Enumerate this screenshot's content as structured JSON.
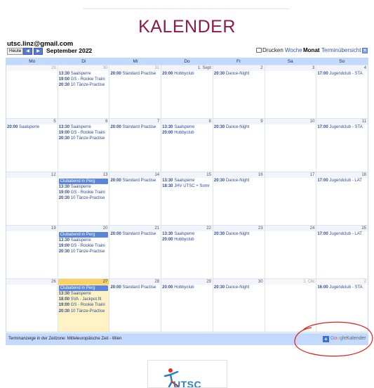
{
  "page": {
    "title": "KALENDER"
  },
  "calendar": {
    "owner": "utsc.linz@gmail.com",
    "toolbar": {
      "today": "Heute",
      "prev": "◀",
      "next": "▶",
      "month": "September 2022",
      "print": "Drucken",
      "week": "Woche",
      "month_view": "Monat",
      "agenda": "Terminübersicht"
    },
    "weekdays": [
      "Mo",
      "Di",
      "Mi",
      "Do",
      "Fr",
      "Sa",
      "So"
    ],
    "weeks": [
      [
        {
          "num": "29",
          "other": true,
          "events": []
        },
        {
          "num": "30",
          "other": true,
          "events": [
            {
              "time": "13:30",
              "title": "Saalsperre"
            },
            {
              "time": "19:00",
              "title": "GS - Rookie Traini"
            },
            {
              "time": "20:30",
              "title": "10 Tänze-Practise"
            }
          ]
        },
        {
          "num": "31",
          "other": true,
          "events": [
            {
              "time": "20:00",
              "title": "Standard Practise"
            }
          ]
        },
        {
          "num": "1. Sept",
          "events": [
            {
              "time": "20:00",
              "title": "Hobbyclub"
            }
          ]
        },
        {
          "num": "2",
          "events": [
            {
              "time": "20:30",
              "title": "Dance-Night"
            }
          ]
        },
        {
          "num": "3",
          "events": []
        },
        {
          "num": "4",
          "events": [
            {
              "time": "17:00",
              "title": "Jugendclub - STA"
            }
          ]
        }
      ],
      [
        {
          "num": "5",
          "events": [
            {
              "time": "20:00",
              "title": "Saalsperre"
            }
          ]
        },
        {
          "num": "6",
          "events": [
            {
              "time": "13:30",
              "title": "Saalsperre"
            },
            {
              "time": "19:00",
              "title": "GS - Rookie Traini"
            },
            {
              "time": "20:30",
              "title": "10 Tänze-Practise"
            }
          ]
        },
        {
          "num": "7",
          "events": [
            {
              "time": "20:00",
              "title": "Standard Practise"
            }
          ]
        },
        {
          "num": "8",
          "events": [
            {
              "time": "13:30",
              "title": "Saalsperre"
            },
            {
              "time": "20:00",
              "title": "Hobbyclub"
            }
          ]
        },
        {
          "num": "9",
          "events": [
            {
              "time": "20:30",
              "title": "Dance-Night"
            }
          ]
        },
        {
          "num": "10",
          "events": []
        },
        {
          "num": "11",
          "events": [
            {
              "time": "17:00",
              "title": "Jugendclub - STA"
            }
          ]
        }
      ],
      [
        {
          "num": "12",
          "events": []
        },
        {
          "num": "13",
          "events": [
            {
              "allday": true,
              "title": "Clubabend in Perg"
            },
            {
              "time": "13:30",
              "title": "Saalsperre"
            },
            {
              "time": "19:00",
              "title": "GS - Rookie Traini"
            },
            {
              "time": "20:30",
              "title": "10 Tänze-Practise"
            }
          ]
        },
        {
          "num": "14",
          "events": [
            {
              "time": "20:00",
              "title": "Standard Practise"
            }
          ]
        },
        {
          "num": "15",
          "events": [
            {
              "time": "13:30",
              "title": "Saalsperre"
            },
            {
              "time": "18:30",
              "title": "JHV UTSC + Somr"
            }
          ]
        },
        {
          "num": "16",
          "events": [
            {
              "time": "20:30",
              "title": "Dance-Night"
            }
          ]
        },
        {
          "num": "17",
          "events": []
        },
        {
          "num": "18",
          "events": [
            {
              "time": "17:00",
              "title": "Jugendclub - LAT"
            }
          ]
        }
      ],
      [
        {
          "num": "19",
          "events": []
        },
        {
          "num": "20",
          "events": [
            {
              "allday": true,
              "title": "Clubabend in Perg"
            },
            {
              "time": "13:30",
              "title": "Saalsperre"
            },
            {
              "time": "19:00",
              "title": "GS - Rookie Traini"
            },
            {
              "time": "20:30",
              "title": "10 Tänze-Practise"
            }
          ]
        },
        {
          "num": "21",
          "events": [
            {
              "time": "20:00",
              "title": "Standard Practise"
            }
          ]
        },
        {
          "num": "22",
          "events": [
            {
              "time": "13:30",
              "title": "Saalsperre"
            },
            {
              "time": "20:00",
              "title": "Hobbyclub"
            }
          ]
        },
        {
          "num": "23",
          "events": [
            {
              "time": "20:30",
              "title": "Dance-Night"
            }
          ]
        },
        {
          "num": "24",
          "events": []
        },
        {
          "num": "25",
          "events": [
            {
              "time": "17:00",
              "title": "Jugendclub - LAT"
            }
          ]
        }
      ],
      [
        {
          "num": "26",
          "events": []
        },
        {
          "num": "27",
          "today": true,
          "events": [
            {
              "allday": true,
              "title": "Clubabend in Perg"
            },
            {
              "time": "13:30",
              "title": "Saalsperre"
            },
            {
              "time": "18:00",
              "title": "SVA - Jackpot.fit"
            },
            {
              "time": "19:00",
              "title": "GS - Rookie Traini"
            },
            {
              "time": "20:30",
              "title": "10 Tänze-Practise"
            }
          ]
        },
        {
          "num": "28",
          "events": [
            {
              "time": "20:00",
              "title": "Standard Practise"
            }
          ]
        },
        {
          "num": "29",
          "events": [
            {
              "time": "20:00",
              "title": "Hobbyclub"
            }
          ]
        },
        {
          "num": "30",
          "events": [
            {
              "time": "20:30",
              "title": "Dance-Night"
            }
          ]
        },
        {
          "num": "1. Okt",
          "other": true,
          "events": []
        },
        {
          "num": "2",
          "other": true,
          "events": [
            {
              "time": "16:00",
              "title": "Jugendclub - STA"
            }
          ]
        }
      ]
    ],
    "footer": {
      "timezone": "Terminanzeige in der Zeitzone: Mitteleuropäische Zeit - Wien",
      "badge_plus": "+",
      "badge_google": [
        "G",
        "o",
        "o",
        "g",
        "l",
        "e"
      ],
      "badge_kalender": "Kalender"
    }
  },
  "logo": {
    "text": "UTSC LINZ"
  },
  "colors": {
    "title": "#8d1a4c",
    "grid_header": "#c3d9ff",
    "today_bg": "#fff3c6",
    "allday_event": "#5b85d6",
    "annotation": "#e0201b"
  }
}
